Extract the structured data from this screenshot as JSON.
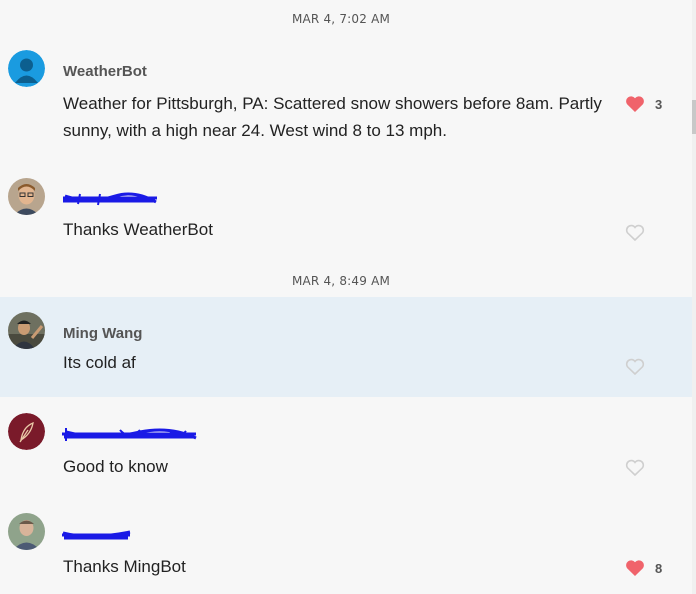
{
  "timestamps": [
    "MAR 4, 7:02 AM",
    "MAR 4, 8:49 AM"
  ],
  "messages": [
    {
      "author": "WeatherBot",
      "text": "Weather for Pittsburgh, PA: Scattered snow showers before 8am. Partly sunny, with a high near 24. West wind 8 to 13 mph.",
      "likes": "3",
      "liked": true
    },
    {
      "author": "",
      "text": "Thanks WeatherBot",
      "likes": "",
      "liked": false
    },
    {
      "author": "Ming Wang",
      "text": "Its cold af",
      "likes": "",
      "liked": false
    },
    {
      "author": "",
      "text": "Good to know",
      "likes": "",
      "liked": false
    },
    {
      "author": "",
      "text": "Thanks MingBot",
      "likes": "8",
      "liked": true
    }
  ],
  "colors": {
    "heart_filled": "#f0636b",
    "heart_empty": "#cfcfcf",
    "highlight_row": "#e6eff6",
    "scribble": "#1a1ae6"
  }
}
